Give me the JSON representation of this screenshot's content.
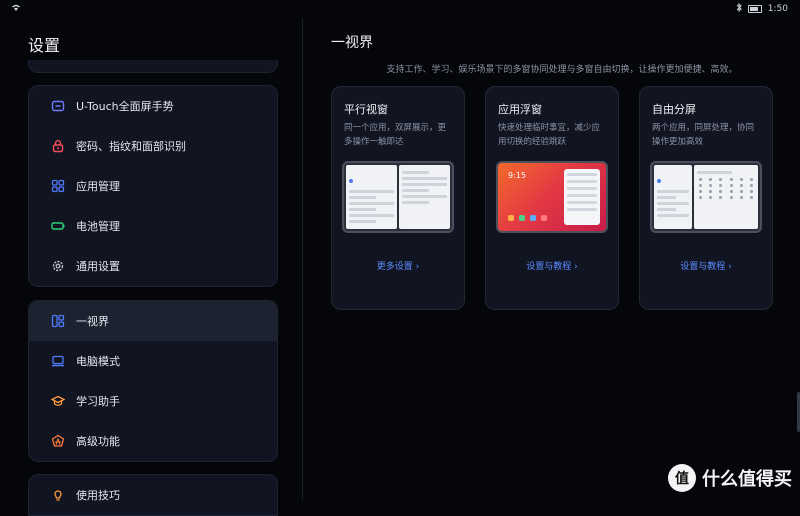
{
  "status": {
    "time": "1:50"
  },
  "left": {
    "title": "设置",
    "group1": [
      {
        "label": "U-Touch全面屏手势",
        "icon": "gesture-icon",
        "color": "#6b7cff"
      },
      {
        "label": "密码、指纹和面部识别",
        "icon": "lock-icon",
        "color": "#ff4d5e"
      },
      {
        "label": "应用管理",
        "icon": "apps-icon",
        "color": "#4f7bff"
      },
      {
        "label": "电池管理",
        "icon": "battery-icon",
        "color": "#2fd17a"
      },
      {
        "label": "通用设置",
        "icon": "gear-icon",
        "color": "#b8bcc7"
      }
    ],
    "group2": [
      {
        "label": "一视界",
        "icon": "split-view-icon",
        "color": "#4f7bff"
      },
      {
        "label": "电脑模式",
        "icon": "laptop-icon",
        "color": "#4f7bff"
      },
      {
        "label": "学习助手",
        "icon": "graduation-cap-icon",
        "color": "#ff9b3d"
      },
      {
        "label": "高级功能",
        "icon": "advanced-icon",
        "color": "#ff7a3d"
      }
    ],
    "group3": [
      {
        "label": "使用技巧",
        "icon": "lightbulb-icon",
        "color": "#ff9b3d"
      }
    ]
  },
  "right": {
    "title": "一视界",
    "description": "支持工作、学习、娱乐场景下的多窗协同处理与多窗自由切换，让操作更加便捷、高效。",
    "cards": [
      {
        "title": "平行视窗",
        "desc": "同一个应用，双屏展示，更多操作一触即达",
        "link": "更多设置 ›"
      },
      {
        "title": "应用浮窗",
        "desc": "快速处理临时事宜，减少应用切换的经验跳跃",
        "link": "设置与教程 ›",
        "thumb_time": "9:15"
      },
      {
        "title": "自由分屏",
        "desc": "两个应用，同屏处理，协同操作更加高效",
        "link": "设置与教程 ›"
      }
    ]
  },
  "watermark": {
    "logo": "值",
    "text": "什么值得买"
  }
}
